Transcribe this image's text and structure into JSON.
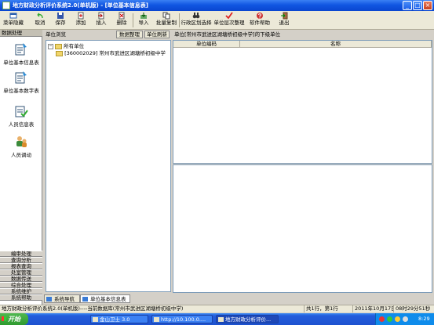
{
  "window": {
    "title": "地方财政分析评价系统2.0(单机版) - [单位基本信息表]",
    "min_glyph": "_",
    "max_glyph": "□",
    "close_glyph": "×"
  },
  "toolbar": {
    "items": [
      {
        "label": "菜单隐藏",
        "icon": "menu-hide-icon"
      },
      {
        "label": "取消",
        "icon": "undo-icon"
      },
      {
        "label": "保存",
        "icon": "save-icon"
      },
      {
        "label": "添加",
        "icon": "add-icon"
      },
      {
        "label": "插入",
        "icon": "insert-icon"
      },
      {
        "label": "删除",
        "icon": "delete-icon"
      },
      {
        "label": "导入",
        "icon": "import-icon"
      },
      {
        "label": "批量复制",
        "icon": "batch-copy-icon"
      },
      {
        "label": "行政区划选择",
        "icon": "region-select-icon"
      },
      {
        "label": "单位层次整理",
        "icon": "unit-hierarchy-icon"
      },
      {
        "label": "软件帮助",
        "icon": "help-icon"
      },
      {
        "label": "退出",
        "icon": "exit-icon"
      }
    ]
  },
  "leftnav": {
    "header": "数据处理",
    "items": [
      {
        "label": "单位基本信息表",
        "icon": "unit-info-icon"
      },
      {
        "label": "单位基本数字表",
        "icon": "unit-numbers-icon"
      },
      {
        "label": "人员信息表",
        "icon": "personnel-info-icon"
      },
      {
        "label": "人员调动",
        "icon": "personnel-transfer-icon"
      }
    ],
    "categories": [
      "编审处理",
      "查询分析",
      "报表查询",
      "处室管理",
      "数据传送",
      "综合处理",
      "系统维护",
      "系统帮助"
    ]
  },
  "treepanel": {
    "header": "单位浏览",
    "btn_tidy": "数据整理",
    "btn_refresh": "单位刷新",
    "root": "所有单位",
    "child": "[360002029] 常州市武进区湖塘桥初级中学"
  },
  "rightpanel": {
    "header": "单位[常州市武进区湖塘桥初级中学]的下级单位",
    "columns": [
      "单位编码",
      "名称"
    ]
  },
  "tabs": [
    "系统导航",
    "单位基本信息表"
  ],
  "statusbar": {
    "info": "地方财政分析评价系统2.0(单机版)----当前数据库(常州市武进区湖塘桥初级中学)",
    "record": "共1行，第1行",
    "date": "2011年10月17日",
    "time": "08时29分51秒"
  },
  "taskbar": {
    "start": "开始",
    "tasks": [
      "金山卫士 3.0",
      "http://10.100.0....",
      "地方财政分析评价..."
    ],
    "clock": "8:29"
  },
  "colors": {
    "titlebar": "#0a46d0",
    "window_bg": "#d4d0c8",
    "taskbar": "#245edc",
    "start_button": "#2f9a2f"
  }
}
